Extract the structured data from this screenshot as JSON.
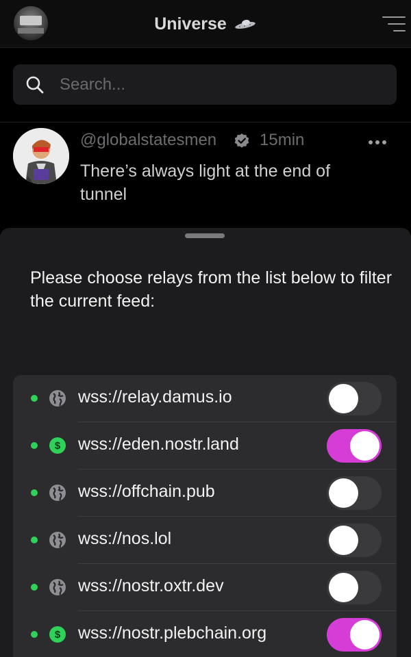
{
  "header": {
    "title": "Universe",
    "title_icon": "ufo-icon",
    "menu_icon": "filter-menu-icon"
  },
  "search": {
    "placeholder": "Search...",
    "value": ""
  },
  "post": {
    "handle": "@globalstatesmen",
    "time": "15min",
    "text": "There’s always light at the end of tunnel",
    "verified": true
  },
  "sheet": {
    "prompt": "Please choose relays from the list below to filter the current feed:",
    "relays": [
      {
        "url": "wss://relay.damus.io",
        "icon": "globe-icon",
        "enabled": false
      },
      {
        "url": "wss://eden.nostr.land",
        "icon": "paid-relay-icon",
        "enabled": true
      },
      {
        "url": "wss://offchain.pub",
        "icon": "globe-icon",
        "enabled": false
      },
      {
        "url": "wss://nos.lol",
        "icon": "globe-icon",
        "enabled": false
      },
      {
        "url": "wss://nostr.oxtr.dev",
        "icon": "globe-icon",
        "enabled": false
      },
      {
        "url": "wss://nostr.plebchain.org",
        "icon": "paid-relay-icon",
        "enabled": true
      }
    ]
  },
  "colors": {
    "accent": "#d63cd6",
    "status_online": "#30d158",
    "paid_icon": "#30d158"
  }
}
